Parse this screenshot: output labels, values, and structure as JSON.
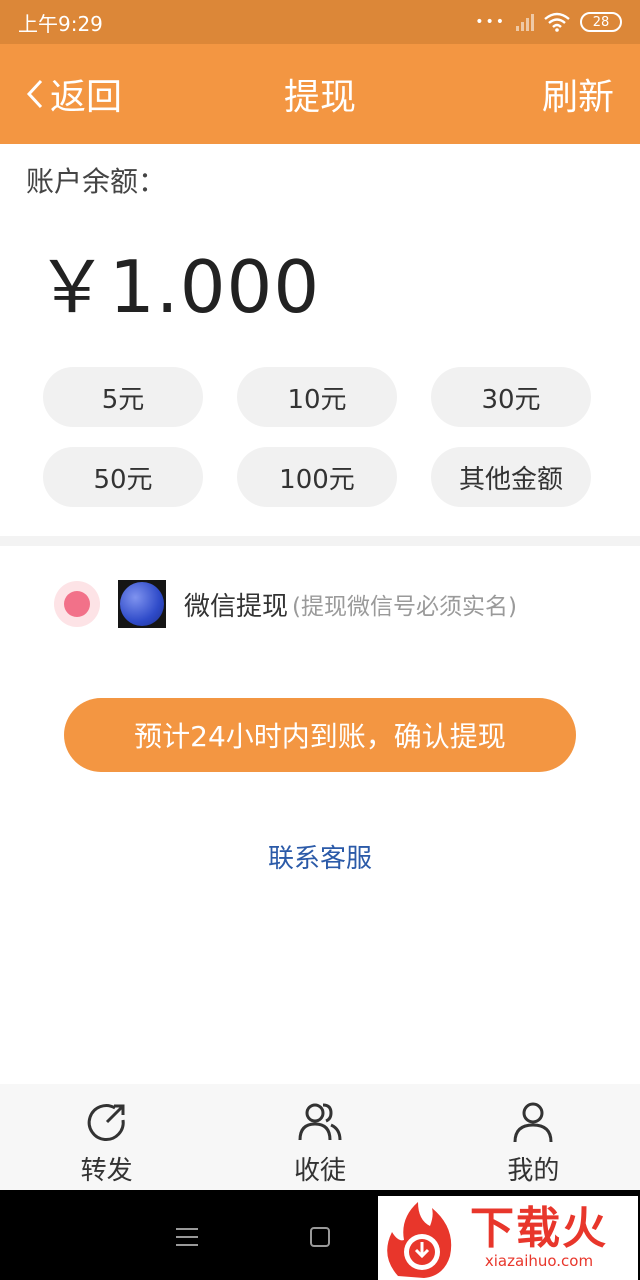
{
  "status_bar": {
    "time": "上午9:29",
    "dots": "•••",
    "battery": "28"
  },
  "nav": {
    "back_label": "返回",
    "title": "提现",
    "refresh_label": "刷新"
  },
  "balance": {
    "label": "账户余额：",
    "amount": "￥1.000"
  },
  "amount_options": [
    {
      "label": "5元"
    },
    {
      "label": "10元"
    },
    {
      "label": "30元"
    },
    {
      "label": "50元"
    },
    {
      "label": "100元"
    },
    {
      "label": "其他金额"
    }
  ],
  "payment_method": {
    "name": "微信提现",
    "note": "(提现微信号必须实名)",
    "selected": true
  },
  "confirm_label": "预计24小时内到账，确认提现",
  "contact_label": "联系客服",
  "tabs": [
    {
      "label": "转发",
      "icon": "share-icon"
    },
    {
      "label": "收徒",
      "icon": "users-icon"
    },
    {
      "label": "我的",
      "icon": "user-icon"
    }
  ],
  "watermark": {
    "title": "下载火",
    "domain": "xiazaihuo.com"
  },
  "colors": {
    "accent": "#f39642",
    "status_bar": "#dc8738",
    "radio": "#f27189",
    "link": "#2b5aa8"
  }
}
